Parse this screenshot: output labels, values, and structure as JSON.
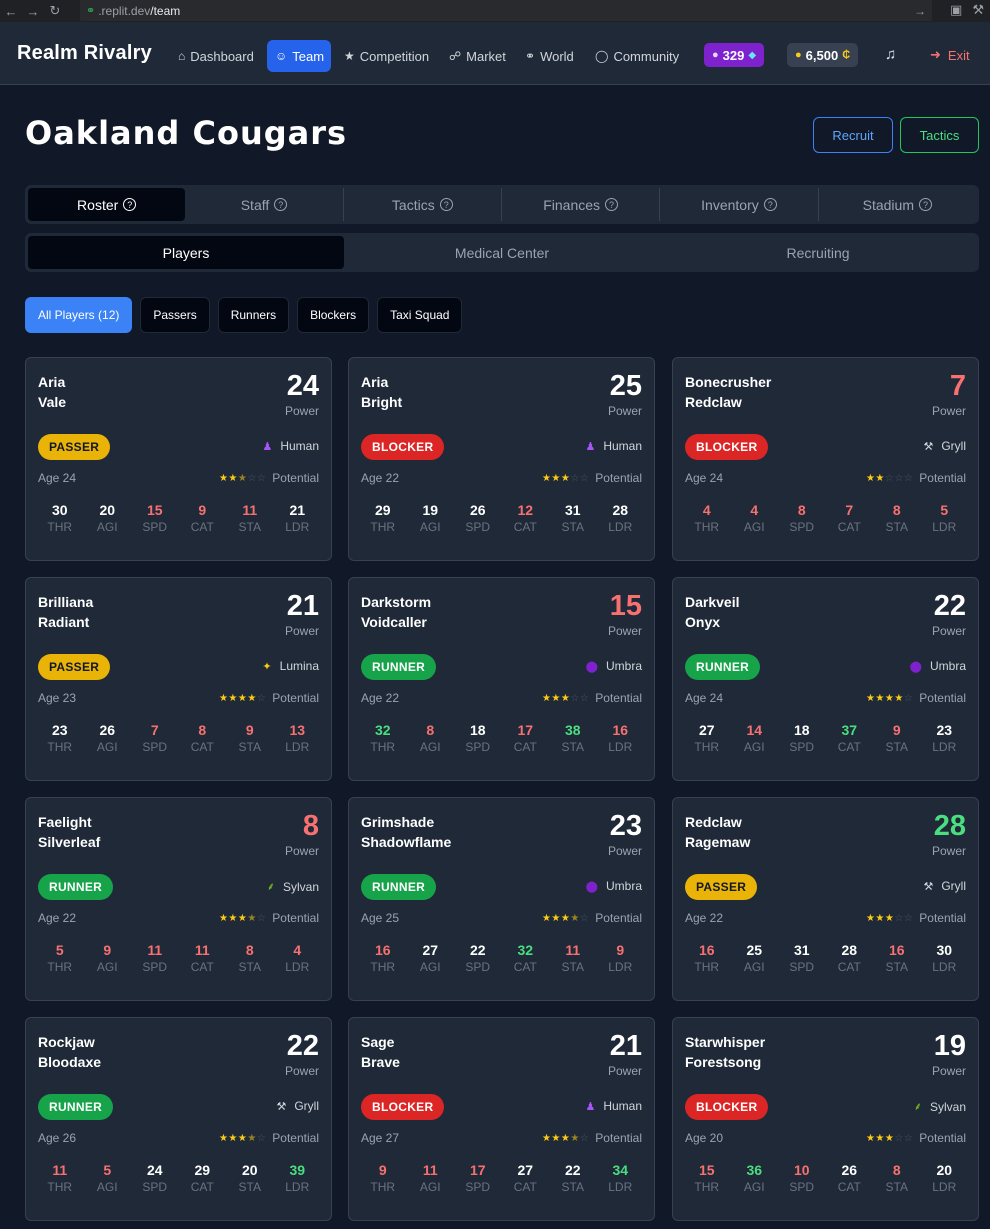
{
  "browser": {
    "url_host": ".replit.dev",
    "url_path": "/team"
  },
  "app": {
    "brand": "Realm Rivalry",
    "nav": [
      {
        "label": "Dashboard",
        "icon": "home-icon",
        "active": false
      },
      {
        "label": "Team",
        "icon": "users-icon",
        "active": true
      },
      {
        "label": "Competition",
        "icon": "trophy-icon",
        "active": false
      },
      {
        "label": "Market",
        "icon": "cart-icon",
        "active": false
      },
      {
        "label": "World",
        "icon": "globe-icon",
        "active": false
      },
      {
        "label": "Community",
        "icon": "chat-icon",
        "active": false
      }
    ],
    "gems": "329",
    "credits": "6,500",
    "exit_label": "Exit"
  },
  "page": {
    "team_name": "Oakland Cougars",
    "recruit_label": "Recruit",
    "tactics_label": "Tactics"
  },
  "tabs": [
    {
      "label": "Roster",
      "active": true
    },
    {
      "label": "Staff",
      "active": false
    },
    {
      "label": "Tactics",
      "active": false
    },
    {
      "label": "Finances",
      "active": false
    },
    {
      "label": "Inventory",
      "active": false
    },
    {
      "label": "Stadium",
      "active": false
    }
  ],
  "subtabs": [
    {
      "label": "Players",
      "active": true
    },
    {
      "label": "Medical Center",
      "active": false
    },
    {
      "label": "Recruiting",
      "active": false
    }
  ],
  "filters": [
    {
      "label": "All Players (12)",
      "active": true
    },
    {
      "label": "Passers",
      "active": false
    },
    {
      "label": "Runners",
      "active": false
    },
    {
      "label": "Blockers",
      "active": false
    },
    {
      "label": "Taxi Squad",
      "active": false
    }
  ],
  "labels": {
    "power": "Power",
    "potential": "Potential",
    "stat_names": [
      "THR",
      "AGI",
      "SPD",
      "CAT",
      "STA",
      "LDR"
    ]
  },
  "colors": {
    "high": "#4ade80",
    "normal": "#ffffff",
    "low": "#f87171",
    "passer": "#eab308",
    "blocker": "#dc2626",
    "runner": "#16a34a"
  },
  "players": [
    {
      "first": "Aria",
      "last": "Vale",
      "power": "24",
      "power_level": "normal",
      "role": "PASSER",
      "species": "Human",
      "species_icon": "human-icon",
      "age": "Age 24",
      "stars": 2.5,
      "stats": [
        30,
        20,
        15,
        9,
        11,
        21
      ]
    },
    {
      "first": "Aria",
      "last": "Bright",
      "power": "25",
      "power_level": "normal",
      "role": "BLOCKER",
      "species": "Human",
      "species_icon": "human-icon",
      "age": "Age 22",
      "stars": 3,
      "stats": [
        29,
        19,
        26,
        12,
        31,
        28
      ]
    },
    {
      "first": "Bonecrusher",
      "last": "Redclaw",
      "power": "7",
      "power_level": "low",
      "role": "BLOCKER",
      "species": "Gryll",
      "species_icon": "hammer-icon",
      "age": "Age 24",
      "stars": 2,
      "stats": [
        4,
        4,
        8,
        7,
        8,
        5
      ]
    },
    {
      "first": "Brilliana",
      "last": "Radiant",
      "power": "21",
      "power_level": "normal",
      "role": "PASSER",
      "species": "Lumina",
      "species_icon": "sparkle-icon",
      "age": "Age 23",
      "stars": 4,
      "stats": [
        23,
        26,
        7,
        8,
        9,
        13
      ]
    },
    {
      "first": "Darkstorm",
      "last": "Voidcaller",
      "power": "15",
      "power_level": "low",
      "role": "RUNNER",
      "species": "Umbra",
      "species_icon": "shadow-orb-icon",
      "age": "Age 22",
      "stars": 3,
      "stats": [
        32,
        8,
        18,
        17,
        38,
        16
      ]
    },
    {
      "first": "Darkveil",
      "last": "Onyx",
      "power": "22",
      "power_level": "normal",
      "role": "RUNNER",
      "species": "Umbra",
      "species_icon": "shadow-orb-icon",
      "age": "Age 24",
      "stars": 4,
      "stats": [
        27,
        14,
        18,
        37,
        9,
        23
      ]
    },
    {
      "first": "Faelight",
      "last": "Silverleaf",
      "power": "8",
      "power_level": "low",
      "role": "RUNNER",
      "species": "Sylvan",
      "species_icon": "leaf-icon",
      "age": "Age 22",
      "stars": 3.5,
      "stats": [
        5,
        9,
        11,
        11,
        8,
        4
      ]
    },
    {
      "first": "Grimshade",
      "last": "Shadowflame",
      "power": "23",
      "power_level": "normal",
      "role": "RUNNER",
      "species": "Umbra",
      "species_icon": "shadow-orb-icon",
      "age": "Age 25",
      "stars": 3.5,
      "stats": [
        16,
        27,
        22,
        32,
        11,
        9
      ]
    },
    {
      "first": "Redclaw",
      "last": "Ragemaw",
      "power": "28",
      "power_level": "high",
      "role": "PASSER",
      "species": "Gryll",
      "species_icon": "hammer-icon",
      "age": "Age 22",
      "stars": 3,
      "stats": [
        16,
        25,
        31,
        28,
        16,
        30
      ]
    },
    {
      "first": "Rockjaw",
      "last": "Bloodaxe",
      "power": "22",
      "power_level": "normal",
      "role": "RUNNER",
      "species": "Gryll",
      "species_icon": "hammer-icon",
      "age": "Age 26",
      "stars": 3.5,
      "stats": [
        11,
        5,
        24,
        29,
        20,
        39
      ]
    },
    {
      "first": "Sage",
      "last": "Brave",
      "power": "21",
      "power_level": "normal",
      "role": "BLOCKER",
      "species": "Human",
      "species_icon": "human-icon",
      "age": "Age 27",
      "stars": 3.5,
      "stats": [
        9,
        11,
        17,
        27,
        22,
        34
      ]
    },
    {
      "first": "Starwhisper",
      "last": "Forestsong",
      "power": "19",
      "power_level": "normal",
      "role": "BLOCKER",
      "species": "Sylvan",
      "species_icon": "leaf-icon",
      "age": "Age 20",
      "stars": 3,
      "stats": [
        15,
        36,
        10,
        26,
        8,
        20
      ]
    }
  ]
}
